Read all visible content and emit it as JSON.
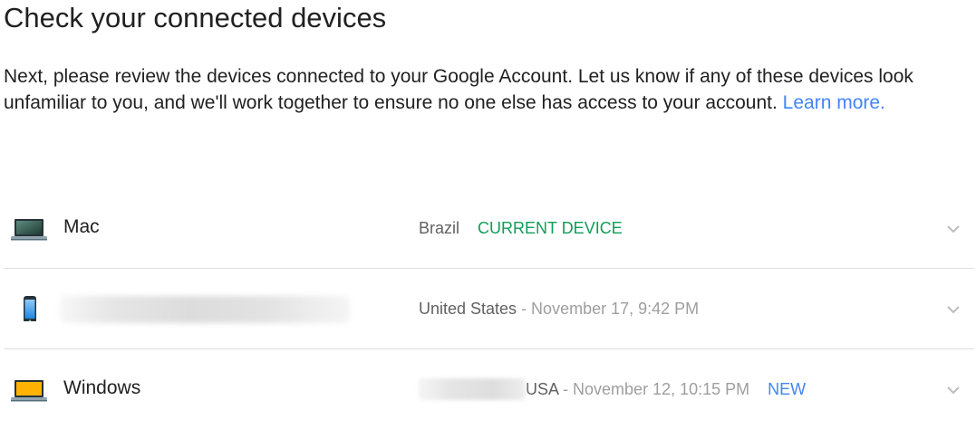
{
  "page": {
    "title": "Check your connected devices",
    "description": "Next, please review the devices connected to your Google Account. Let us know if any of these devices look unfamiliar to you, and we'll work together to ensure no one else has access to your account. ",
    "learn_more": "Learn more."
  },
  "devices": [
    {
      "icon": "laptop-mac-icon",
      "name": "Mac",
      "location": "Brazil",
      "status": "CURRENT DEVICE",
      "expand_icon": "chevron-down-icon"
    },
    {
      "icon": "iphone-icon",
      "name": "",
      "name_redacted": true,
      "location": "United States",
      "time": " - November 17, 9:42 PM",
      "expand_icon": "chevron-down-icon"
    },
    {
      "icon": "laptop-windows-icon",
      "name": "Windows",
      "location_redacted": true,
      "location": "USA",
      "time": " - November 12, 10:15 PM",
      "badge": "NEW",
      "expand_icon": "chevron-down-icon"
    }
  ],
  "colors": {
    "link": "#4285f4",
    "current_device": "#0f9d58",
    "new_badge": "#4285f4",
    "divider": "#e0e0e0"
  }
}
